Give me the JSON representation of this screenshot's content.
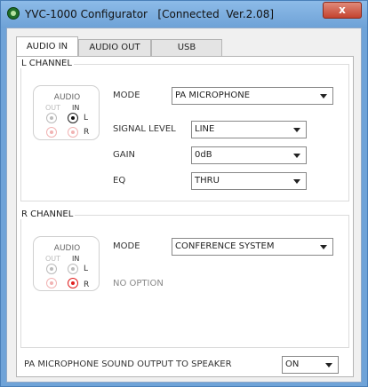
{
  "window": {
    "title": "YVC-1000 Configurator   [Connected  Ver.2.08]",
    "close_label": "x"
  },
  "tabs": [
    {
      "label": "AUDIO IN",
      "active": true
    },
    {
      "label": "AUDIO OUT",
      "active": false
    },
    {
      "label": "USB",
      "active": false
    }
  ],
  "l_channel": {
    "group_label": "L CHANNEL",
    "audio_box": {
      "title": "AUDIO",
      "out_label": "OUT",
      "in_label": "IN",
      "l_label": "L",
      "r_label": "R",
      "selected_in": "L"
    },
    "mode_label": "MODE",
    "mode_value": "PA MICROPHONE",
    "signal_level_label": "SIGNAL LEVEL",
    "signal_level_value": "LINE",
    "gain_label": "GAIN",
    "gain_value": "0dB",
    "eq_label": "EQ",
    "eq_value": "THRU"
  },
  "r_channel": {
    "group_label": "R CHANNEL",
    "audio_box": {
      "title": "AUDIO",
      "out_label": "OUT",
      "in_label": "IN",
      "l_label": "L",
      "r_label": "R",
      "selected_in": "R"
    },
    "mode_label": "MODE",
    "mode_value": "CONFERENCE SYSTEM",
    "no_option_label": "NO OPTION"
  },
  "footer": {
    "speaker_output_label": "PA MICROPHONE SOUND OUTPUT TO SPEAKER",
    "speaker_output_value": "ON"
  },
  "colors": {
    "titlebar": "#6ea2d7",
    "selected_red": "#e02020",
    "selected_black": "#111111"
  }
}
